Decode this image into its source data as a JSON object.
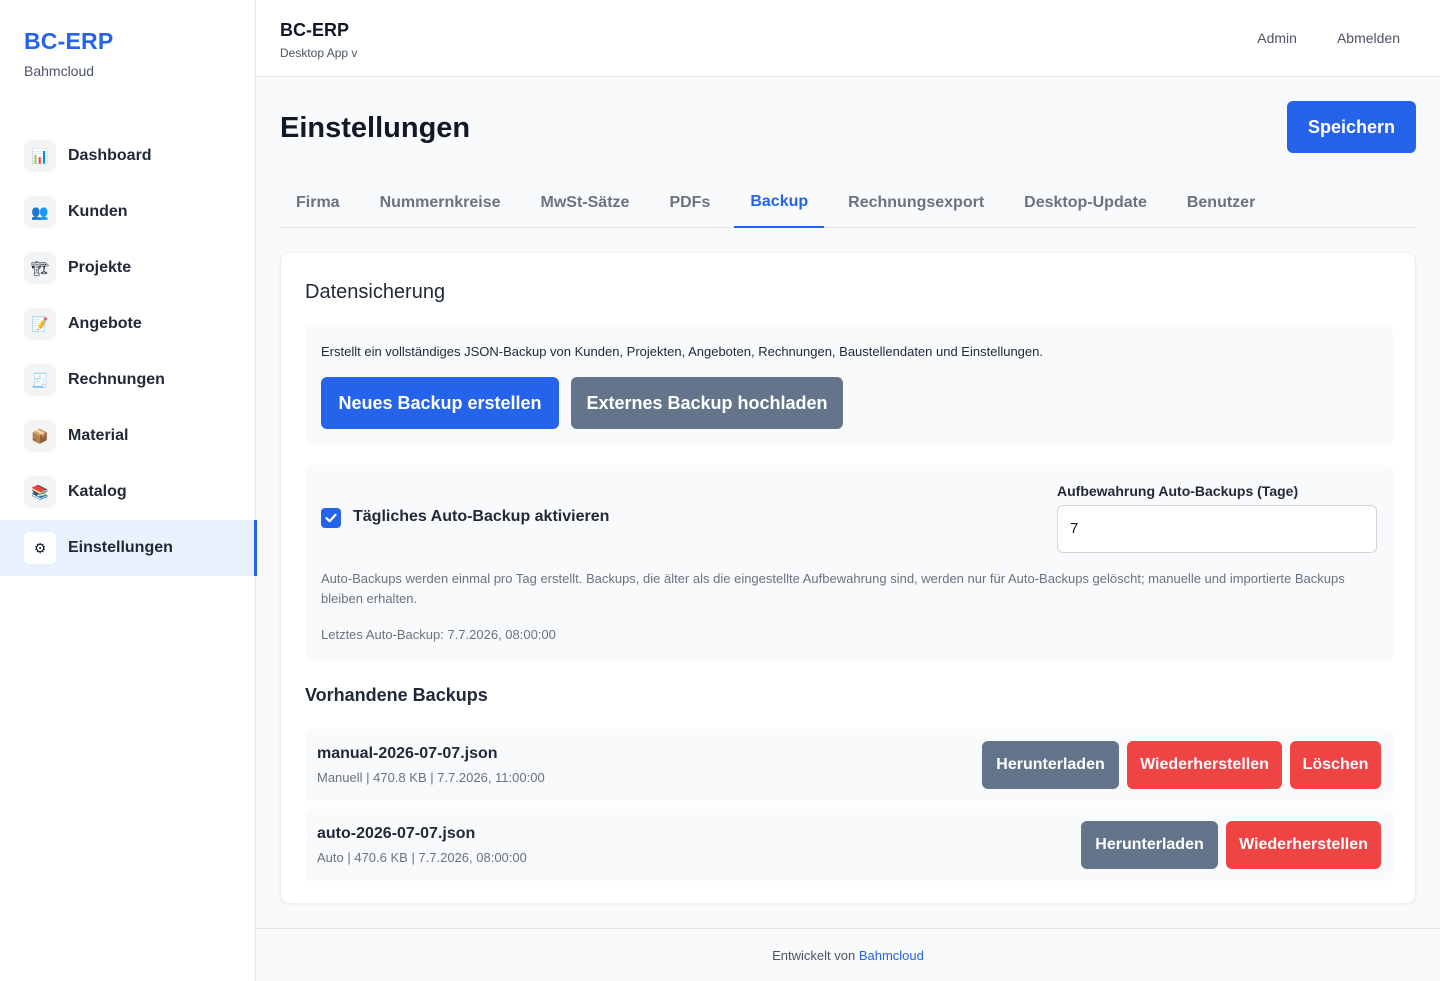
{
  "brand": {
    "title": "BC-ERP",
    "subtitle": "Bahmcloud"
  },
  "sidebar": {
    "items": [
      {
        "label": "Dashboard",
        "icon": "📊"
      },
      {
        "label": "Kunden",
        "icon": "👥"
      },
      {
        "label": "Projekte",
        "icon": "🏗"
      },
      {
        "label": "Angebote",
        "icon": "📝"
      },
      {
        "label": "Rechnungen",
        "icon": "🧾"
      },
      {
        "label": "Material",
        "icon": "📦"
      },
      {
        "label": "Katalog",
        "icon": "📚"
      },
      {
        "label": "Einstellungen",
        "icon": "⚙"
      }
    ],
    "active": "Einstellungen"
  },
  "topbar": {
    "title": "BC-ERP",
    "subtitle": "Desktop App v",
    "admin": "Admin",
    "logout": "Abmelden"
  },
  "page": {
    "title": "Einstellungen",
    "save": "Speichern"
  },
  "tabs": [
    "Firma",
    "Nummernkreise",
    "MwSt-Sätze",
    "PDFs",
    "Backup",
    "Rechnungsexport",
    "Desktop-Update",
    "Benutzer"
  ],
  "active_tab": "Backup",
  "backup": {
    "title": "Datensicherung",
    "description": "Erstellt ein vollständiges JSON-Backup von Kunden, Projekten, Angeboten, Rechnungen, Baustellendaten und Einstellungen.",
    "create_btn": "Neues Backup erstellen",
    "upload_btn": "Externes Backup hochladen",
    "auto_label": "Tägliches Auto-Backup aktivieren",
    "auto_enabled": true,
    "retention_label": "Aufbewahrung Auto-Backups (Tage)",
    "retention_value": "7",
    "note": "Auto-Backups werden einmal pro Tag erstellt. Backups, die älter als die eingestellte Aufbewahrung sind, werden nur für Auto-Backups gelöscht; manuelle und importierte Backups bleiben erhalten.",
    "last_auto": "Letztes Auto-Backup: 7.7.2026, 08:00:00"
  },
  "existing": {
    "title": "Vorhandene Backups",
    "rows": [
      {
        "name": "manual-2026-07-07.json",
        "meta": "Manuell | 470.8 KB | 7.7.2026, 11:00:00",
        "download": "Herunterladen",
        "restore": "Wiederherstellen",
        "delete": "Löschen"
      },
      {
        "name": "auto-2026-07-07.json",
        "meta": "Auto | 470.6 KB | 7.7.2026, 08:00:00",
        "download": "Herunterladen",
        "restore": "Wiederherstellen"
      }
    ]
  },
  "footer": {
    "prefix": "Entwickelt von",
    "link": "Bahmcloud"
  },
  "colors": {
    "primary": "#2563eb",
    "gray_button": "#64748b",
    "danger": "#ef4444"
  }
}
